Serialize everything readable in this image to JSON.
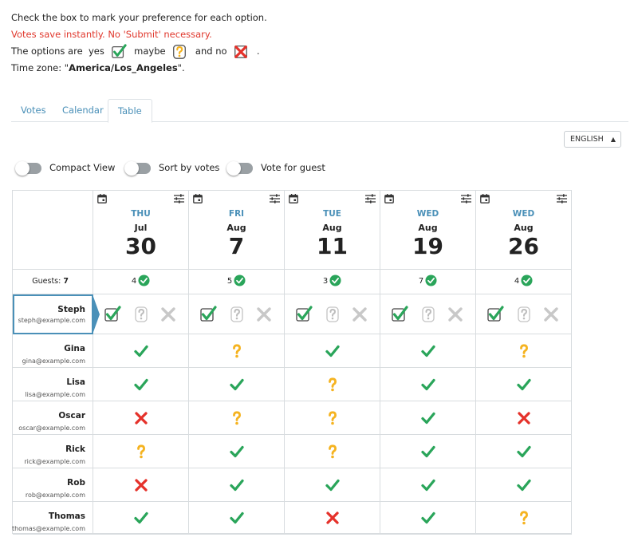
{
  "intro": {
    "line1": "Check the box to mark your preference for each option.",
    "line2": "Votes save instantly. No 'Submit' necessary.",
    "line3_prefix": "The options are",
    "opt_yes": "yes",
    "opt_maybe": "maybe",
    "opt_no": "and no",
    "line3_end": ".",
    "tz_prefix": "Time zone: \"",
    "tz_value": "America/Los_Angeles",
    "tz_suffix": "\"."
  },
  "tabs": [
    {
      "label": "Votes"
    },
    {
      "label": "Calendar"
    },
    {
      "label": "Table"
    }
  ],
  "active_tab": "Table",
  "language": {
    "selected": "ENGLISH"
  },
  "toggles": [
    {
      "label": "Compact View"
    },
    {
      "label": "Sort by votes"
    },
    {
      "label": "Vote for guest"
    }
  ],
  "guests": {
    "label": "Guests:",
    "count": "7"
  },
  "dates": [
    {
      "dow": "THU",
      "month": "Jul",
      "day": "30",
      "count": "4"
    },
    {
      "dow": "FRI",
      "month": "Aug",
      "day": "7",
      "count": "5"
    },
    {
      "dow": "TUE",
      "month": "Aug",
      "day": "11",
      "count": "3"
    },
    {
      "dow": "WED",
      "month": "Aug",
      "day": "19",
      "count": "7"
    },
    {
      "dow": "WED",
      "month": "Aug",
      "day": "26",
      "count": "4"
    }
  ],
  "current_user": {
    "name": "Steph",
    "email": "steph@example.com",
    "selected": [
      "yes",
      "yes",
      "yes",
      "yes",
      "yes"
    ]
  },
  "participants": [
    {
      "name": "Gina",
      "email": "gina@example.com",
      "votes": [
        "yes",
        "maybe",
        "yes",
        "yes",
        "maybe"
      ]
    },
    {
      "name": "Lisa",
      "email": "lisa@example.com",
      "votes": [
        "yes",
        "yes",
        "maybe",
        "yes",
        "yes"
      ]
    },
    {
      "name": "Oscar",
      "email": "oscar@example.com",
      "votes": [
        "no",
        "maybe",
        "maybe",
        "yes",
        "no"
      ]
    },
    {
      "name": "Rick",
      "email": "rick@example.com",
      "votes": [
        "maybe",
        "yes",
        "maybe",
        "yes",
        "yes"
      ]
    },
    {
      "name": "Rob",
      "email": "rob@example.com",
      "votes": [
        "no",
        "yes",
        "yes",
        "yes",
        "yes"
      ]
    },
    {
      "name": "Thomas",
      "email": "thomas@example.com",
      "votes": [
        "yes",
        "yes",
        "no",
        "yes",
        "maybe"
      ]
    }
  ],
  "colors": {
    "yes": "#2aa55a",
    "maybe": "#f5b320",
    "no": "#e5312a",
    "accent": "#4a90b8",
    "notice": "#e0372c"
  }
}
